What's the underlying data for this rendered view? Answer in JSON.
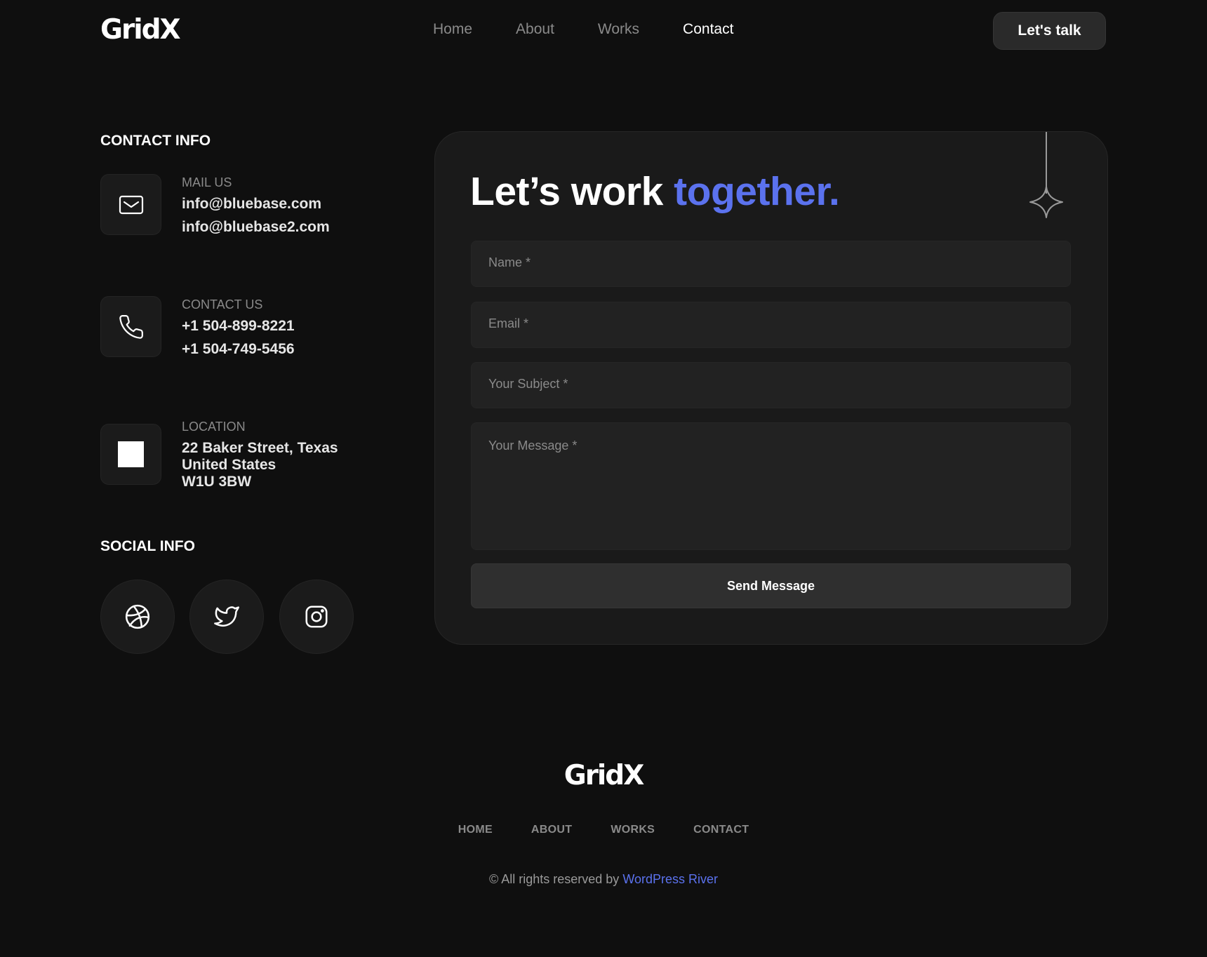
{
  "brand": {
    "logo_text": "GridX"
  },
  "nav": {
    "items": [
      {
        "label": "Home"
      },
      {
        "label": "About"
      },
      {
        "label": "Works"
      },
      {
        "label": "Contact"
      }
    ],
    "active": "Contact",
    "cta_label": "Let's talk"
  },
  "contact_info": {
    "title": "CONTACT INFO",
    "mail": {
      "label": "MAIL US",
      "values": [
        "info@bluebase.com",
        "info@bluebase2.com"
      ],
      "icon": "mail-icon"
    },
    "phone": {
      "label": "CONTACT US",
      "values": [
        "+1 504-899-8221",
        "+1 504-749-5456"
      ],
      "icon": "phone-icon"
    },
    "location": {
      "label": "LOCATION",
      "lines": [
        "22 Baker Street, Texas",
        "United States",
        "W1U 3BW"
      ],
      "icon": "location-icon"
    }
  },
  "social_info": {
    "title": "SOCIAL INFO",
    "icons": [
      "dribbble-icon",
      "twitter-icon",
      "instagram-icon"
    ]
  },
  "form": {
    "title_main": "Let’s work ",
    "title_accent": "together.",
    "name_placeholder": "Name *",
    "email_placeholder": "Email *",
    "subject_placeholder": "Your Subject *",
    "message_placeholder": "Your Message *",
    "submit_label": "Send Message"
  },
  "footer": {
    "logo_text": "GridX",
    "nav": [
      "HOME",
      "ABOUT",
      "WORKS",
      "CONTACT"
    ],
    "copyright_prefix": "© All rights reserved by ",
    "copyright_link": "WordPress River"
  },
  "colors": {
    "background": "#0f0f0f",
    "card": "#1a1a1a",
    "accent": "#5b72ee"
  }
}
